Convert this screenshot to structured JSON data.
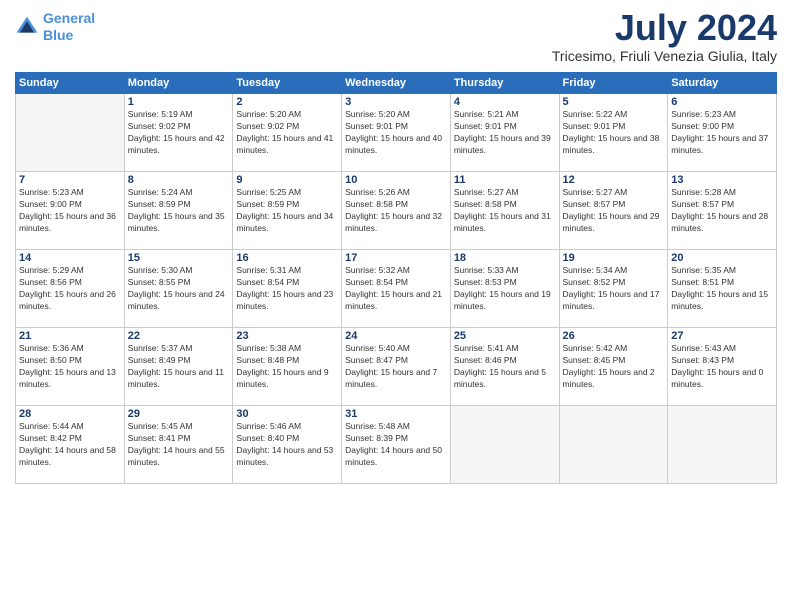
{
  "header": {
    "logo_line1": "General",
    "logo_line2": "Blue",
    "month_year": "July 2024",
    "location": "Tricesimo, Friuli Venezia Giulia, Italy"
  },
  "weekdays": [
    "Sunday",
    "Monday",
    "Tuesday",
    "Wednesday",
    "Thursday",
    "Friday",
    "Saturday"
  ],
  "weeks": [
    [
      {
        "day": "",
        "sunrise": "",
        "sunset": "",
        "daylight": ""
      },
      {
        "day": "1",
        "sunrise": "Sunrise: 5:19 AM",
        "sunset": "Sunset: 9:02 PM",
        "daylight": "Daylight: 15 hours and 42 minutes."
      },
      {
        "day": "2",
        "sunrise": "Sunrise: 5:20 AM",
        "sunset": "Sunset: 9:02 PM",
        "daylight": "Daylight: 15 hours and 41 minutes."
      },
      {
        "day": "3",
        "sunrise": "Sunrise: 5:20 AM",
        "sunset": "Sunset: 9:01 PM",
        "daylight": "Daylight: 15 hours and 40 minutes."
      },
      {
        "day": "4",
        "sunrise": "Sunrise: 5:21 AM",
        "sunset": "Sunset: 9:01 PM",
        "daylight": "Daylight: 15 hours and 39 minutes."
      },
      {
        "day": "5",
        "sunrise": "Sunrise: 5:22 AM",
        "sunset": "Sunset: 9:01 PM",
        "daylight": "Daylight: 15 hours and 38 minutes."
      },
      {
        "day": "6",
        "sunrise": "Sunrise: 5:23 AM",
        "sunset": "Sunset: 9:00 PM",
        "daylight": "Daylight: 15 hours and 37 minutes."
      }
    ],
    [
      {
        "day": "7",
        "sunrise": "Sunrise: 5:23 AM",
        "sunset": "Sunset: 9:00 PM",
        "daylight": "Daylight: 15 hours and 36 minutes."
      },
      {
        "day": "8",
        "sunrise": "Sunrise: 5:24 AM",
        "sunset": "Sunset: 8:59 PM",
        "daylight": "Daylight: 15 hours and 35 minutes."
      },
      {
        "day": "9",
        "sunrise": "Sunrise: 5:25 AM",
        "sunset": "Sunset: 8:59 PM",
        "daylight": "Daylight: 15 hours and 34 minutes."
      },
      {
        "day": "10",
        "sunrise": "Sunrise: 5:26 AM",
        "sunset": "Sunset: 8:58 PM",
        "daylight": "Daylight: 15 hours and 32 minutes."
      },
      {
        "day": "11",
        "sunrise": "Sunrise: 5:27 AM",
        "sunset": "Sunset: 8:58 PM",
        "daylight": "Daylight: 15 hours and 31 minutes."
      },
      {
        "day": "12",
        "sunrise": "Sunrise: 5:27 AM",
        "sunset": "Sunset: 8:57 PM",
        "daylight": "Daylight: 15 hours and 29 minutes."
      },
      {
        "day": "13",
        "sunrise": "Sunrise: 5:28 AM",
        "sunset": "Sunset: 8:57 PM",
        "daylight": "Daylight: 15 hours and 28 minutes."
      }
    ],
    [
      {
        "day": "14",
        "sunrise": "Sunrise: 5:29 AM",
        "sunset": "Sunset: 8:56 PM",
        "daylight": "Daylight: 15 hours and 26 minutes."
      },
      {
        "day": "15",
        "sunrise": "Sunrise: 5:30 AM",
        "sunset": "Sunset: 8:55 PM",
        "daylight": "Daylight: 15 hours and 24 minutes."
      },
      {
        "day": "16",
        "sunrise": "Sunrise: 5:31 AM",
        "sunset": "Sunset: 8:54 PM",
        "daylight": "Daylight: 15 hours and 23 minutes."
      },
      {
        "day": "17",
        "sunrise": "Sunrise: 5:32 AM",
        "sunset": "Sunset: 8:54 PM",
        "daylight": "Daylight: 15 hours and 21 minutes."
      },
      {
        "day": "18",
        "sunrise": "Sunrise: 5:33 AM",
        "sunset": "Sunset: 8:53 PM",
        "daylight": "Daylight: 15 hours and 19 minutes."
      },
      {
        "day": "19",
        "sunrise": "Sunrise: 5:34 AM",
        "sunset": "Sunset: 8:52 PM",
        "daylight": "Daylight: 15 hours and 17 minutes."
      },
      {
        "day": "20",
        "sunrise": "Sunrise: 5:35 AM",
        "sunset": "Sunset: 8:51 PM",
        "daylight": "Daylight: 15 hours and 15 minutes."
      }
    ],
    [
      {
        "day": "21",
        "sunrise": "Sunrise: 5:36 AM",
        "sunset": "Sunset: 8:50 PM",
        "daylight": "Daylight: 15 hours and 13 minutes."
      },
      {
        "day": "22",
        "sunrise": "Sunrise: 5:37 AM",
        "sunset": "Sunset: 8:49 PM",
        "daylight": "Daylight: 15 hours and 11 minutes."
      },
      {
        "day": "23",
        "sunrise": "Sunrise: 5:38 AM",
        "sunset": "Sunset: 8:48 PM",
        "daylight": "Daylight: 15 hours and 9 minutes."
      },
      {
        "day": "24",
        "sunrise": "Sunrise: 5:40 AM",
        "sunset": "Sunset: 8:47 PM",
        "daylight": "Daylight: 15 hours and 7 minutes."
      },
      {
        "day": "25",
        "sunrise": "Sunrise: 5:41 AM",
        "sunset": "Sunset: 8:46 PM",
        "daylight": "Daylight: 15 hours and 5 minutes."
      },
      {
        "day": "26",
        "sunrise": "Sunrise: 5:42 AM",
        "sunset": "Sunset: 8:45 PM",
        "daylight": "Daylight: 15 hours and 2 minutes."
      },
      {
        "day": "27",
        "sunrise": "Sunrise: 5:43 AM",
        "sunset": "Sunset: 8:43 PM",
        "daylight": "Daylight: 15 hours and 0 minutes."
      }
    ],
    [
      {
        "day": "28",
        "sunrise": "Sunrise: 5:44 AM",
        "sunset": "Sunset: 8:42 PM",
        "daylight": "Daylight: 14 hours and 58 minutes."
      },
      {
        "day": "29",
        "sunrise": "Sunrise: 5:45 AM",
        "sunset": "Sunset: 8:41 PM",
        "daylight": "Daylight: 14 hours and 55 minutes."
      },
      {
        "day": "30",
        "sunrise": "Sunrise: 5:46 AM",
        "sunset": "Sunset: 8:40 PM",
        "daylight": "Daylight: 14 hours and 53 minutes."
      },
      {
        "day": "31",
        "sunrise": "Sunrise: 5:48 AM",
        "sunset": "Sunset: 8:39 PM",
        "daylight": "Daylight: 14 hours and 50 minutes."
      },
      {
        "day": "",
        "sunrise": "",
        "sunset": "",
        "daylight": ""
      },
      {
        "day": "",
        "sunrise": "",
        "sunset": "",
        "daylight": ""
      },
      {
        "day": "",
        "sunrise": "",
        "sunset": "",
        "daylight": ""
      }
    ]
  ]
}
